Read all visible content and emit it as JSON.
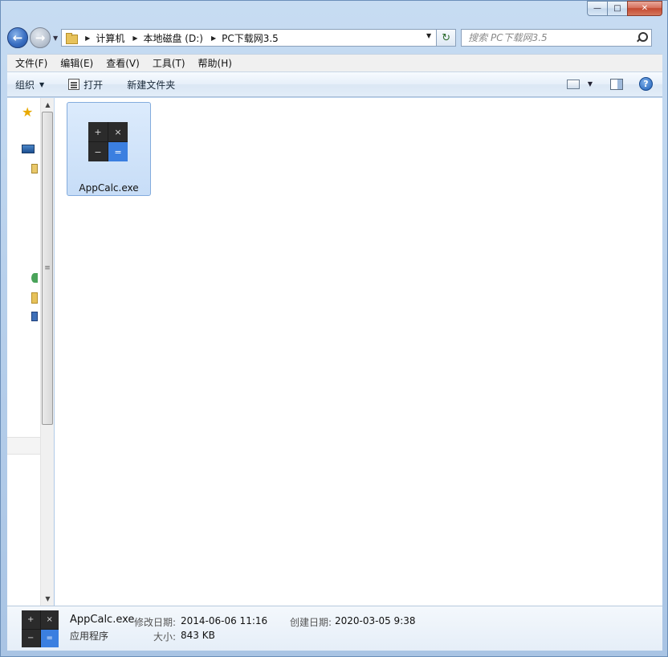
{
  "window": {
    "caption": {
      "minimize": "—",
      "maximize": "□",
      "close": "✕"
    }
  },
  "nav": {
    "back_glyph": "←",
    "forward_glyph": "→",
    "breadcrumbs": [
      "计算机",
      "本地磁盘 (D:)",
      "PC下载网3.5"
    ],
    "refresh_glyph": "↻",
    "search_placeholder": "搜索 PC下载网3.5"
  },
  "menu": {
    "items": [
      "文件(F)",
      "编辑(E)",
      "查看(V)",
      "工具(T)",
      "帮助(H)"
    ]
  },
  "toolbar": {
    "organize": "组织",
    "open": "打开",
    "new_folder": "新建文件夹",
    "help_glyph": "?"
  },
  "scrollbar": {
    "up": "▲",
    "down": "▼",
    "grip": "≡"
  },
  "nav_pane": {
    "favorites_icon": "★"
  },
  "files": [
    {
      "name": "AppCalc.exe",
      "icon": "calculator-icon",
      "icon_glyphs": [
        "+",
        "×",
        "−",
        "="
      ]
    }
  ],
  "status": {
    "name": "AppCalc.exe",
    "type": "应用程序",
    "modified_label": "修改日期:",
    "modified_value": "2014-06-06 11:16",
    "created_label": "创建日期:",
    "created_value": "2020-03-05 9:38",
    "size_label": "大小:",
    "size_value": "843 KB"
  },
  "colors": {
    "accent": "#3b7fe0",
    "selection": "#c7ddf7"
  }
}
